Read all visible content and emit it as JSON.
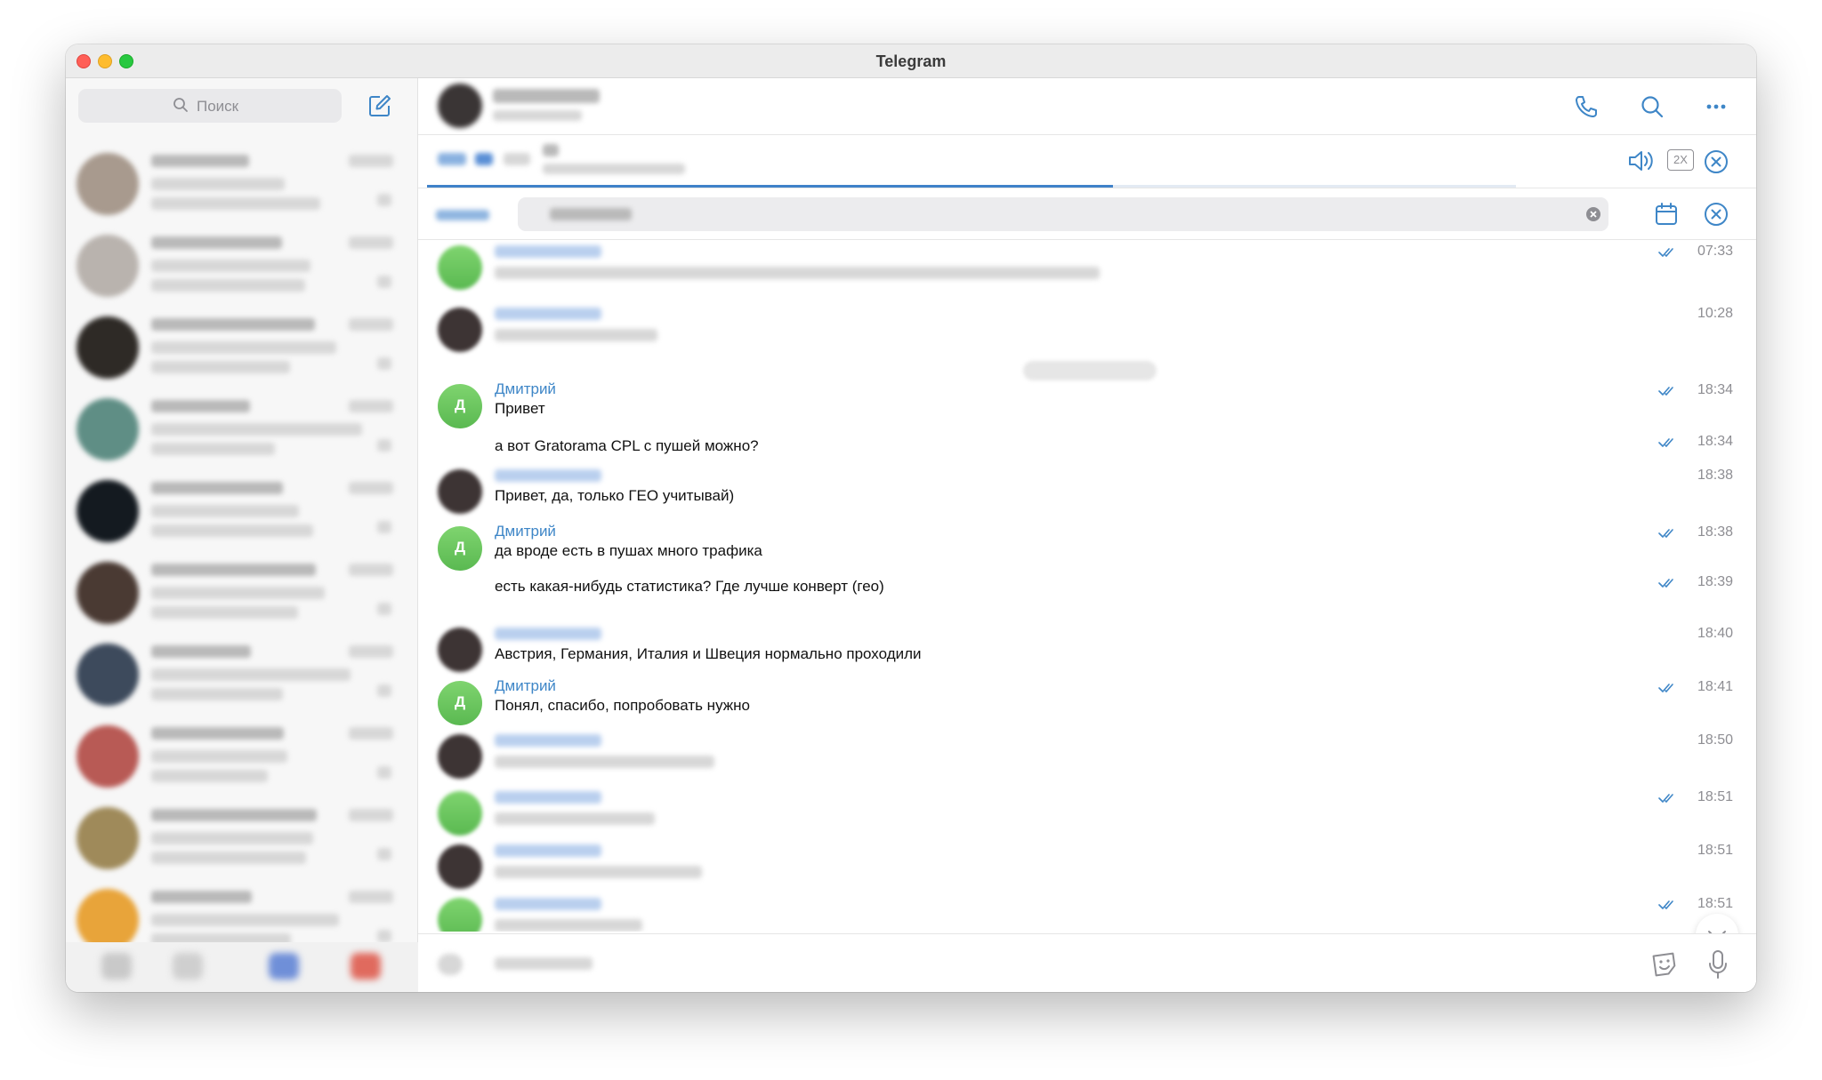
{
  "window": {
    "title": "Telegram"
  },
  "sidebar": {
    "search_placeholder": "Поиск",
    "chats": [
      {
        "avatar_color": "#a89a8e"
      },
      {
        "avatar_color": "#b9b3ae"
      },
      {
        "avatar_color": "#2e2a26"
      },
      {
        "avatar_color": "#5f8e85"
      },
      {
        "avatar_color": "#141a20"
      },
      {
        "avatar_color": "#4a3a33"
      },
      {
        "avatar_color": "#3d4a5c"
      },
      {
        "avatar_color": "#b85a55"
      },
      {
        "avatar_color": "#9f8a5a"
      },
      {
        "avatar_color": "#e8a43a"
      }
    ]
  },
  "messages": [
    {
      "avatar": "green-blur",
      "time": "07:33",
      "read": true
    },
    {
      "avatar": "photo",
      "time": "10:28",
      "read": false
    },
    {
      "avatar": "green",
      "letter": "Д",
      "name": "Дмитрий",
      "text": "Привет",
      "time": "18:34",
      "read": true
    },
    {
      "text": "а вот Gratorama CPL с пушей можно?",
      "time": "18:34",
      "read": true
    },
    {
      "avatar": "photo",
      "text": "Привет, да, только ГЕО учитывай)",
      "time": "18:38",
      "read": false
    },
    {
      "avatar": "green",
      "letter": "Д",
      "name": "Дмитрий",
      "text": "да вроде есть в пушах много трафика",
      "time": "18:38",
      "read": true
    },
    {
      "text": "есть какая-нибудь статистика? Где лучше конверт (гео)",
      "time": "18:39",
      "read": true
    },
    {
      "avatar": "photo",
      "text": "Австрия, Германия, Италия и Швеция нормально проходили",
      "time": "18:40",
      "read": false
    },
    {
      "avatar": "green",
      "letter": "Д",
      "name": "Дмитрий",
      "text": "Понял, спасибо, попробовать нужно",
      "time": "18:41",
      "read": true
    },
    {
      "avatar": "photo",
      "time": "18:50",
      "read": false
    },
    {
      "avatar": "green-blur",
      "time": "18:51",
      "read": true
    },
    {
      "avatar": "photo",
      "time": "18:51",
      "read": false
    },
    {
      "avatar": "green-blur",
      "time": "18:51",
      "read": true
    }
  ],
  "player": {
    "speed_label": "2X",
    "progress": 0.63
  },
  "colors": {
    "accent": "#3e86c7",
    "avatar_green": "#68c05c"
  },
  "icons": [
    "search-icon",
    "compose-icon",
    "phone-icon",
    "more-icon",
    "volume-icon",
    "close-icon",
    "calendar-icon",
    "chevron-down-icon",
    "sticker-icon",
    "microphone-icon"
  ]
}
